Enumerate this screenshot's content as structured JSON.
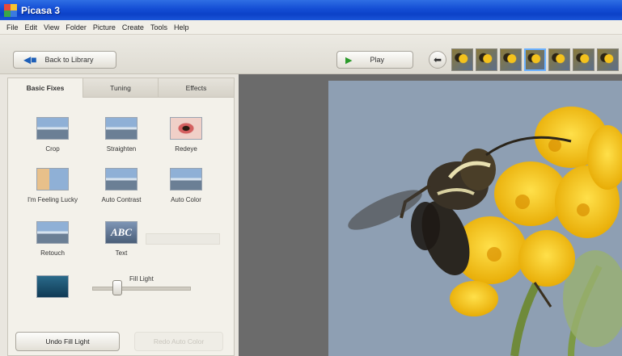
{
  "window": {
    "title": "Picasa 3"
  },
  "menu": [
    "File",
    "Edit",
    "View",
    "Folder",
    "Picture",
    "Create",
    "Tools",
    "Help"
  ],
  "toolbar": {
    "back_label": "Back to Library",
    "play_label": "Play",
    "prev_icon": "left-arrow-icon",
    "thumbnail_count": 7,
    "selected_thumbnail_index": 3
  },
  "tabs": [
    {
      "label": "Basic Fixes",
      "active": true
    },
    {
      "label": "Tuning",
      "active": false
    },
    {
      "label": "Effects",
      "active": false
    }
  ],
  "tools": [
    {
      "label": "Crop",
      "icon": "crop-icon"
    },
    {
      "label": "Straighten",
      "icon": "straighten-icon"
    },
    {
      "label": "Redeye",
      "icon": "redeye-icon"
    },
    {
      "label": "I'm Feeling Lucky",
      "icon": "feeling-lucky-icon"
    },
    {
      "label": "Auto Contrast",
      "icon": "auto-contrast-icon"
    },
    {
      "label": "Auto Color",
      "icon": "auto-color-icon"
    },
    {
      "label": "Retouch",
      "icon": "retouch-icon"
    },
    {
      "label": "Text",
      "icon": "text-icon",
      "glyph": "ABC"
    },
    {
      "label": "",
      "icon": "fill-light-icon"
    }
  ],
  "fill_light": {
    "label": "Fill Light",
    "value": 0.25
  },
  "buttons": {
    "undo": "Undo Fill Light",
    "redo": "Redo Auto Color"
  },
  "colors": {
    "title_bar": "#0c41c8",
    "photo_background": "#6b6b6b",
    "flower": "#f4c21c"
  }
}
